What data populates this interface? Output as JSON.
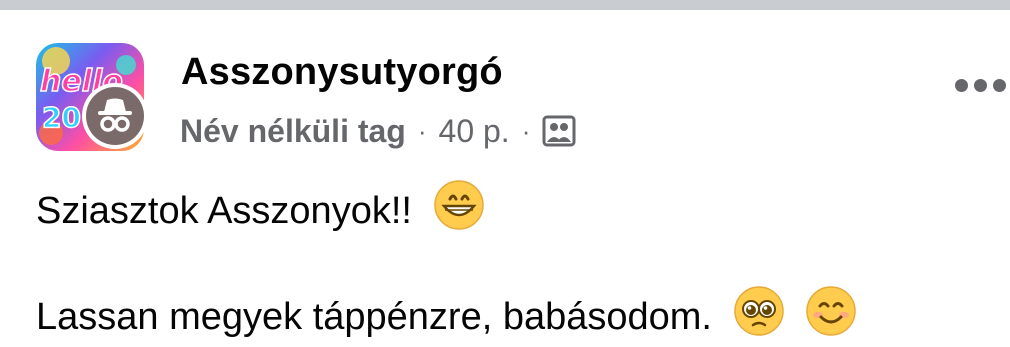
{
  "post": {
    "group_name": "Asszonysutyorgó",
    "author": "Név nélküli tag",
    "separator": "·",
    "time": "40 p.",
    "privacy_icon": "group-members-icon",
    "more_icon": "more-options-icon"
  },
  "avatar": {
    "group_picture_text": "hello 20",
    "badge_icon": "anonymous-spy-icon"
  },
  "content": {
    "line1": "Sziasztok Asszonyok!!",
    "line1_emoji": "grinning-face-icon",
    "line2": "Lassan megyek táppénzre, babásodom.",
    "line2_emojis": [
      "pleading-face-icon",
      "smiling-face-icon"
    ]
  },
  "colors": {
    "divider": "#c9ccd1",
    "secondary_text": "#65676b",
    "emoji_yellow": "#ffcc4d"
  }
}
